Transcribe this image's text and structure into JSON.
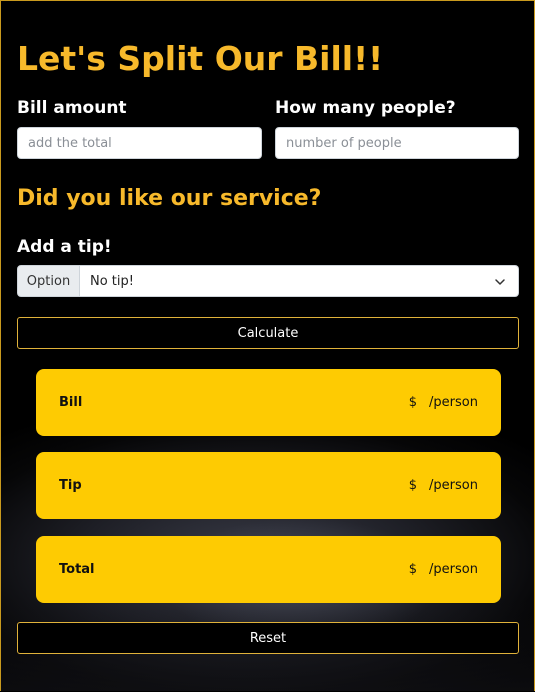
{
  "header": {
    "title": "Let's Split Our Bill!!"
  },
  "form": {
    "bill_label": "Bill amount",
    "bill_placeholder": "add the total",
    "people_label": "How many people?",
    "people_placeholder": "number of people",
    "service_question": "Did you like our service?",
    "tip_label": "Add a tip!",
    "tip_addon": "Option",
    "tip_selected": "No tip!",
    "calculate_label": "Calculate"
  },
  "results": [
    {
      "name": "Bill",
      "currency": "$",
      "unit": "/person"
    },
    {
      "name": "Tip",
      "currency": "$",
      "unit": "/person"
    },
    {
      "name": "Total",
      "currency": "$",
      "unit": "/person"
    }
  ],
  "reset_label": "Reset",
  "colors": {
    "accent": "#f7b92b",
    "card": "#fecb02",
    "button_border": "#e0b23a",
    "background": "#000000"
  },
  "icons": {
    "select": "chevron-down-icon"
  }
}
